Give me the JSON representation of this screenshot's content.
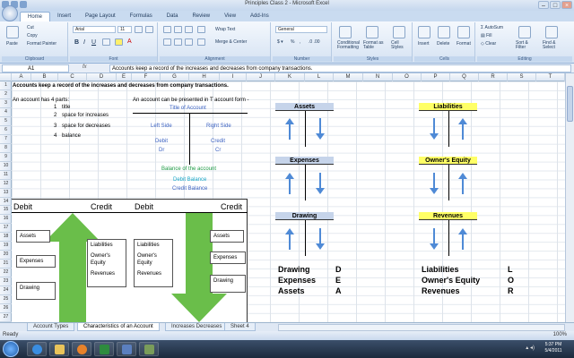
{
  "window": {
    "title": "Principles Class 2 - Microsoft Excel"
  },
  "ribbon_tabs": [
    "Home",
    "Insert",
    "Page Layout",
    "Formulas",
    "Data",
    "Review",
    "View",
    "Add-Ins"
  ],
  "ribbon": {
    "clipboard": {
      "paste": "Paste",
      "cut": "Cut",
      "copy": "Copy",
      "format_painter": "Format Painter",
      "label": "Clipboard"
    },
    "font": {
      "name": "Arial",
      "size": "11",
      "label": "Font"
    },
    "alignment": {
      "wrap": "Wrap Text",
      "merge": "Merge & Center",
      "label": "Alignment"
    },
    "number": {
      "format": "General",
      "label": "Number"
    },
    "styles": {
      "cond": "Conditional Formatting",
      "table": "Format as Table",
      "cell": "Cell Styles",
      "label": "Styles"
    },
    "cells": {
      "insert": "Insert",
      "delete": "Delete",
      "format": "Format",
      "label": "Cells"
    },
    "editing": {
      "autosum": "AutoSum",
      "fill": "Fill",
      "clear": "Clear",
      "sort": "Sort & Filter",
      "find": "Find & Select",
      "label": "Editing"
    }
  },
  "formula_bar": {
    "name_box": "A1",
    "fx": "fx",
    "content": "Accounts keep a record of the increases and decreases from company transactions."
  },
  "columns": [
    "A",
    "B",
    "C",
    "D",
    "E",
    "F",
    "G",
    "H",
    "I",
    "J",
    "K",
    "L",
    "M",
    "N",
    "O",
    "P",
    "Q",
    "R",
    "S",
    "T"
  ],
  "rows": [
    "1",
    "2",
    "3",
    "4",
    "5",
    "6",
    "7",
    "8",
    "9",
    "10",
    "11",
    "12",
    "13",
    "14",
    "15",
    "16",
    "17",
    "18",
    "19",
    "20",
    "21",
    "22",
    "23",
    "24",
    "25",
    "26",
    "27"
  ],
  "sheet": {
    "r1": "Accounts keep a record of the increases and decreases from company transactions.",
    "parts_intro": "An account has 4 parts:",
    "parts": [
      {
        "n": "1",
        "t": "title"
      },
      {
        "n": "2",
        "t": "space for increases"
      },
      {
        "n": "3",
        "t": "space for decreases"
      },
      {
        "n": "4",
        "t": "balance"
      }
    ],
    "tform_intro": "An account can be presented in T account form -",
    "title_of_account": "Title of Account",
    "left_side": "Left Side",
    "right_side": "Right Side",
    "debit": "Debit",
    "credit": "Credit",
    "dr": "Dr",
    "cr": "Cr",
    "balance_of_account": "Balance of the account",
    "debit_balance": "Debit Balance",
    "credit_balance": "Credit Balance",
    "t_accounts": [
      {
        "name": "Assets"
      },
      {
        "name": "Expenses"
      },
      {
        "name": "Drawing"
      },
      {
        "name": "Liabilities"
      },
      {
        "name": "Owner's Equity"
      },
      {
        "name": "Revenues"
      }
    ],
    "acronym_left": [
      {
        "acct": "Drawing",
        "letter": "D"
      },
      {
        "acct": "Expenses",
        "letter": "E"
      },
      {
        "acct": "Assets",
        "letter": "A"
      }
    ],
    "acronym_right": [
      {
        "acct": "Liabilities",
        "letter": "L"
      },
      {
        "acct": "Owner's Equity",
        "letter": "O"
      },
      {
        "acct": "Revenues",
        "letter": "R"
      }
    ],
    "diagram": {
      "debit1": "Debit",
      "credit1": "Credit",
      "debit2": "Debit",
      "credit2": "Credit",
      "left_boxes": [
        "Assets",
        "Expenses",
        "Drawing"
      ],
      "mid_boxes": [
        "Liabilities",
        "Owner's Equity",
        "Revenues"
      ],
      "mid_boxes2": [
        "Liabilities",
        "Owner's Equity",
        "Revenues"
      ],
      "right_boxes": [
        "Assets",
        "Expenses",
        "Drawing"
      ]
    }
  },
  "sheet_tabs": [
    "Account Types",
    "Characteristics of an Account",
    "Increases Decreases",
    "Sheet 4"
  ],
  "active_sheet": "Characteristics of an Account",
  "status": {
    "ready": "Ready",
    "zoom": "100%"
  },
  "clock": {
    "time": "5:37 PM",
    "date": "5/4/2011"
  },
  "colors": {
    "header_fill": "#c6d4ea",
    "yellow": "#ffff66",
    "arrow": "#4f8ad6",
    "green": "#6abe4a"
  }
}
